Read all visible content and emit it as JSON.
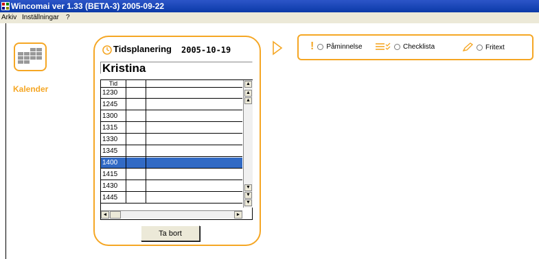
{
  "window": {
    "title": "Wincomai ver 1.33 (BETA-3) 2005-09-22"
  },
  "menu": {
    "items": [
      "Arkiv",
      "Inställningar",
      "?"
    ]
  },
  "sidebar": {
    "calendar_label": "Kalender"
  },
  "planner": {
    "title": "Tidsplanering",
    "date": "2005-10-19",
    "name": "Kristina",
    "column_header": "Tid",
    "rows": [
      "1230",
      "1245",
      "1300",
      "1315",
      "1330",
      "1345",
      "1400",
      "1415",
      "1430",
      "1445"
    ],
    "selected_time": "1400",
    "delete_label": "Ta bort"
  },
  "options": {
    "reminder_label": "Påminnelse",
    "checklist_label": "Checklista",
    "freetext_label": "Fritext"
  },
  "colors": {
    "accent": "#f5a623",
    "selection": "#316ac5",
    "titlebar": "#0b3aa8"
  }
}
